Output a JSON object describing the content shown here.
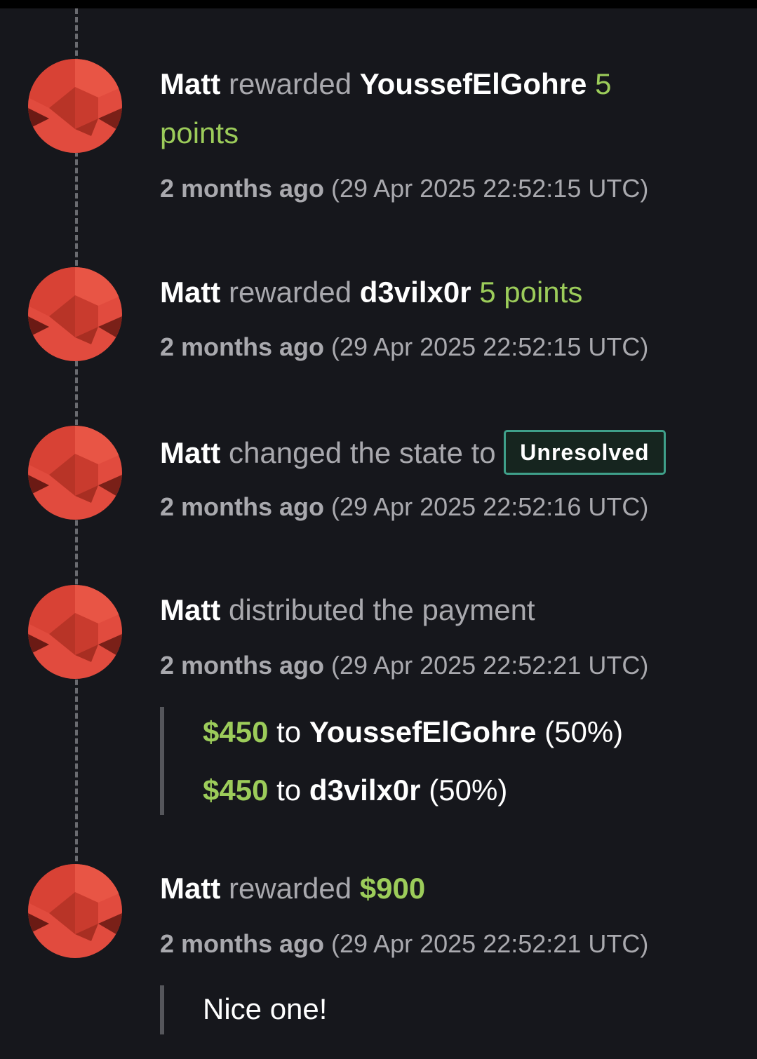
{
  "events": [
    {
      "actor": "Matt",
      "action": "rewarded",
      "target": "YoussefElGohre",
      "amount": "5",
      "amount_wrap": "points",
      "time_relative": "2 months ago",
      "time_absolute": "(29 Apr 2025 22:52:15 UTC)"
    },
    {
      "actor": "Matt",
      "action": "rewarded",
      "target": "d3vilx0r",
      "amount": "5 points",
      "time_relative": "2 months ago",
      "time_absolute": "(29 Apr 2025 22:52:15 UTC)"
    },
    {
      "actor": "Matt",
      "action": "changed the state to",
      "state_badge": "Unresolved",
      "time_relative": "2 months ago",
      "time_absolute": "(29 Apr 2025 22:52:16 UTC)"
    },
    {
      "actor": "Matt",
      "action": "distributed the payment",
      "time_relative": "2 months ago",
      "time_absolute": "(29 Apr 2025 22:52:21 UTC)",
      "payments": [
        {
          "amount": "$450",
          "to": "to",
          "recipient": "YoussefElGohre",
          "share": "(50%)"
        },
        {
          "amount": "$450",
          "to": "to",
          "recipient": "d3vilx0r",
          "share": "(50%)"
        }
      ]
    },
    {
      "actor": "Matt",
      "action": "rewarded",
      "amount": "$900",
      "time_relative": "2 months ago",
      "time_absolute": "(29 Apr 2025 22:52:21 UTC)",
      "comment": "Nice one!"
    }
  ],
  "colors": {
    "background": "#16171c",
    "accent_green": "#9ccc5a",
    "badge_border": "#3fa08a",
    "avatar_red": "#e14b3e"
  },
  "icons": {
    "avatar": "avatar-icon"
  }
}
